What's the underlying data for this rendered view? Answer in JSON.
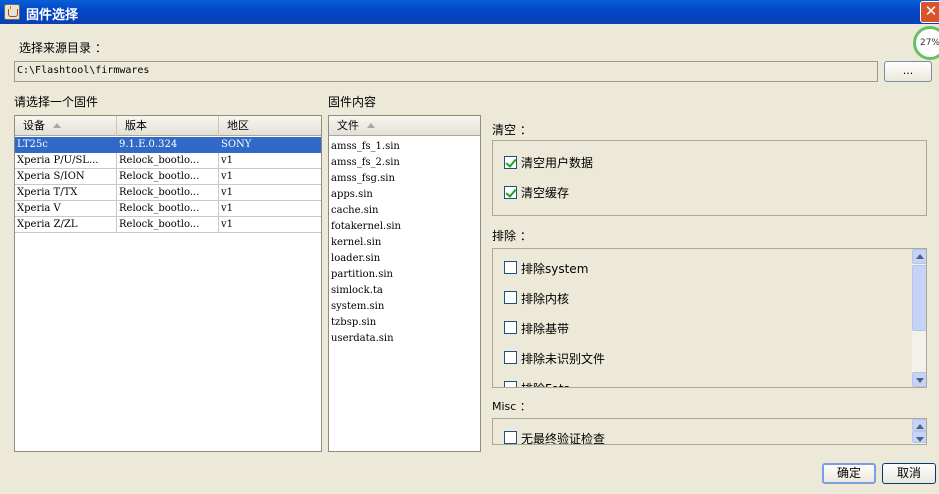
{
  "window": {
    "title": "固件选择",
    "close": "✕"
  },
  "progress": {
    "label": "27%",
    "value": 27
  },
  "source": {
    "label": "选择来源目录 ：",
    "path": "C:\\Flashtool\\firmwares",
    "browse_label": "..."
  },
  "firmware": {
    "label": "请选择一个固件",
    "columns": [
      "设备",
      "版本",
      "地区"
    ],
    "rows": [
      [
        "LT25c",
        "9.1.E.0.324",
        "SONY"
      ],
      [
        "Xperia P/U/SL...",
        "Relock_bootlo...",
        "v1"
      ],
      [
        "Xperia S/ION",
        "Relock_bootlo...",
        "v1"
      ],
      [
        "Xperia T/TX",
        "Relock_bootlo...",
        "v1"
      ],
      [
        "Xperia V",
        "Relock_bootlo...",
        "v1"
      ],
      [
        "Xperia Z/ZL",
        "Relock_bootlo...",
        "v1"
      ]
    ],
    "selected_index": 0
  },
  "contents": {
    "label": "固件内容",
    "column": "文件",
    "files": [
      "amss_fs_1.sin",
      "amss_fs_2.sin",
      "amss_fsg.sin",
      "apps.sin",
      "cache.sin",
      "fotakernel.sin",
      "kernel.sin",
      "loader.sin",
      "partition.sin",
      "simlock.ta",
      "system.sin",
      "tzbsp.sin",
      "userdata.sin"
    ]
  },
  "wipe": {
    "label": "清空 ：",
    "items": [
      {
        "label": "清空用户数据",
        "checked": true
      },
      {
        "label": "清空缓存",
        "checked": true
      }
    ]
  },
  "exclude": {
    "label": "排除 ：",
    "items": [
      {
        "label": "排除system",
        "checked": false
      },
      {
        "label": "排除内核",
        "checked": false
      },
      {
        "label": "排除基带",
        "checked": false
      },
      {
        "label": "排除未识别文件",
        "checked": false
      },
      {
        "label": "排除Fota",
        "checked": false
      }
    ]
  },
  "misc": {
    "label": "Misc ：",
    "items": [
      {
        "label": "无最终验证检查",
        "checked": false
      }
    ]
  },
  "buttons": {
    "ok": "确定",
    "cancel": "取消"
  }
}
